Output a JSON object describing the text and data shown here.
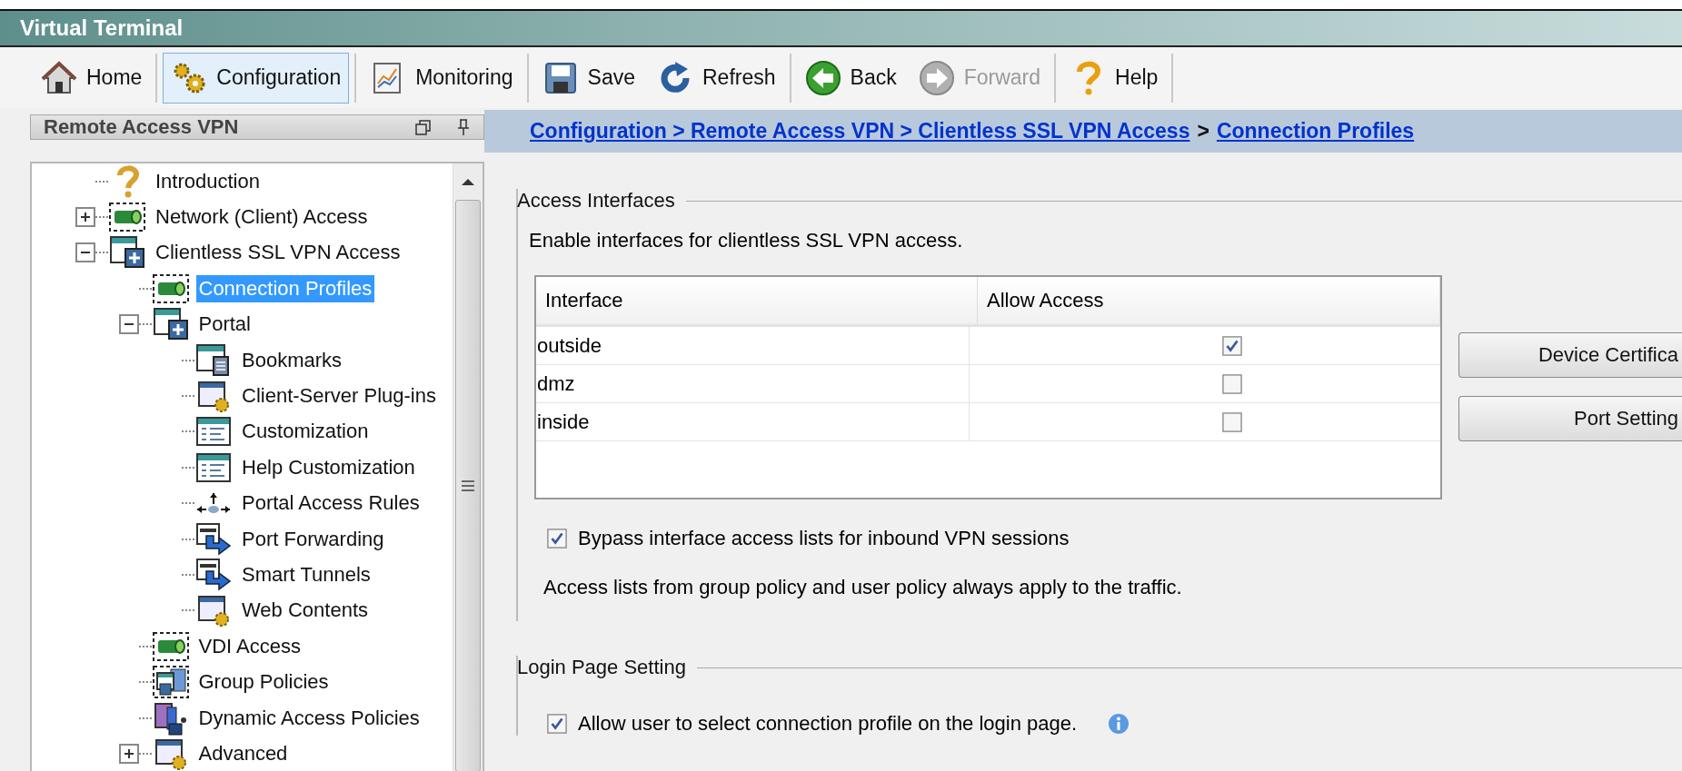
{
  "window": {
    "title": "Virtual Terminal"
  },
  "toolbar": {
    "groups": [
      [
        {
          "label": "Home",
          "kind": "home",
          "selected": false,
          "disabled": false
        }
      ],
      [
        {
          "label": "Configuration",
          "kind": "configuration",
          "selected": true,
          "disabled": false
        }
      ],
      [
        {
          "label": "Monitoring",
          "kind": "monitoring",
          "selected": false,
          "disabled": false
        }
      ],
      [
        {
          "label": "Save",
          "kind": "save",
          "selected": false,
          "disabled": false
        },
        {
          "label": "Refresh",
          "kind": "refresh",
          "selected": false,
          "disabled": false
        }
      ],
      [
        {
          "label": "Back",
          "kind": "back",
          "selected": false,
          "disabled": false
        },
        {
          "label": "Forward",
          "kind": "forward",
          "selected": false,
          "disabled": true
        }
      ],
      [
        {
          "label": "Help",
          "kind": "help",
          "selected": false,
          "disabled": false
        }
      ]
    ]
  },
  "sidebar": {
    "title": "Remote Access VPN",
    "items": [
      {
        "label": "Introduction",
        "kind": "help",
        "selected": false
      },
      {
        "label": "Network (Client) Access",
        "kind": "connection",
        "selected": false,
        "expanded": false
      },
      {
        "label": "Clientless SSL VPN Access",
        "kind": "portal",
        "selected": false,
        "expanded": true,
        "children": [
          {
            "label": "Connection Profiles",
            "kind": "connection",
            "selected": true
          },
          {
            "label": "Portal",
            "kind": "portal",
            "selected": false,
            "expanded": true,
            "children": [
              {
                "label": "Bookmarks",
                "kind": "bookmark",
                "selected": false
              },
              {
                "label": "Client-Server Plug-ins",
                "kind": "plugin",
                "selected": false
              },
              {
                "label": "Customization",
                "kind": "customization",
                "selected": false
              },
              {
                "label": "Help Customization",
                "kind": "customization",
                "selected": false
              },
              {
                "label": "Portal Access Rules",
                "kind": "rules",
                "selected": false
              },
              {
                "label": "Port Forwarding",
                "kind": "forward",
                "selected": false
              },
              {
                "label": "Smart Tunnels",
                "kind": "forward",
                "selected": false
              },
              {
                "label": "Web Contents",
                "kind": "plugin",
                "selected": false
              }
            ]
          },
          {
            "label": "VDI Access",
            "kind": "connection",
            "selected": false
          },
          {
            "label": "Group Policies",
            "kind": "group",
            "selected": false
          },
          {
            "label": "Dynamic Access Policies",
            "kind": "policy",
            "selected": false
          },
          {
            "label": "Advanced",
            "kind": "plugin",
            "selected": false,
            "expanded": false
          }
        ]
      }
    ]
  },
  "breadcrumb": [
    {
      "text": "Configuration > Remote Access VPN > Clientless SSL VPN Access",
      "kind": "link"
    },
    {
      "text": ">",
      "kind": "separator"
    },
    {
      "text": "Connection Profiles",
      "kind": "link"
    }
  ],
  "access_interfaces": {
    "title": "Access Interfaces",
    "description": "Enable interfaces for clientless SSL VPN access.",
    "table": {
      "columns": [
        "Interface",
        "Allow Access"
      ],
      "rows": [
        {
          "interface": "outside",
          "allow_access": true
        },
        {
          "interface": "dmz",
          "allow_access": false
        },
        {
          "interface": "inside",
          "allow_access": false
        }
      ]
    },
    "buttons": [
      "Device Certifica",
      "Port Setting"
    ],
    "bypass": {
      "label": "Bypass interface access lists for inbound VPN sessions",
      "checked": true
    },
    "note": "Access lists from group policy and user policy always apply to the traffic."
  },
  "login_page_setting": {
    "title": "Login Page Setting",
    "options": [
      {
        "label": "Allow user to select connection profile on the login page.",
        "checked": true,
        "info": true
      }
    ]
  }
}
